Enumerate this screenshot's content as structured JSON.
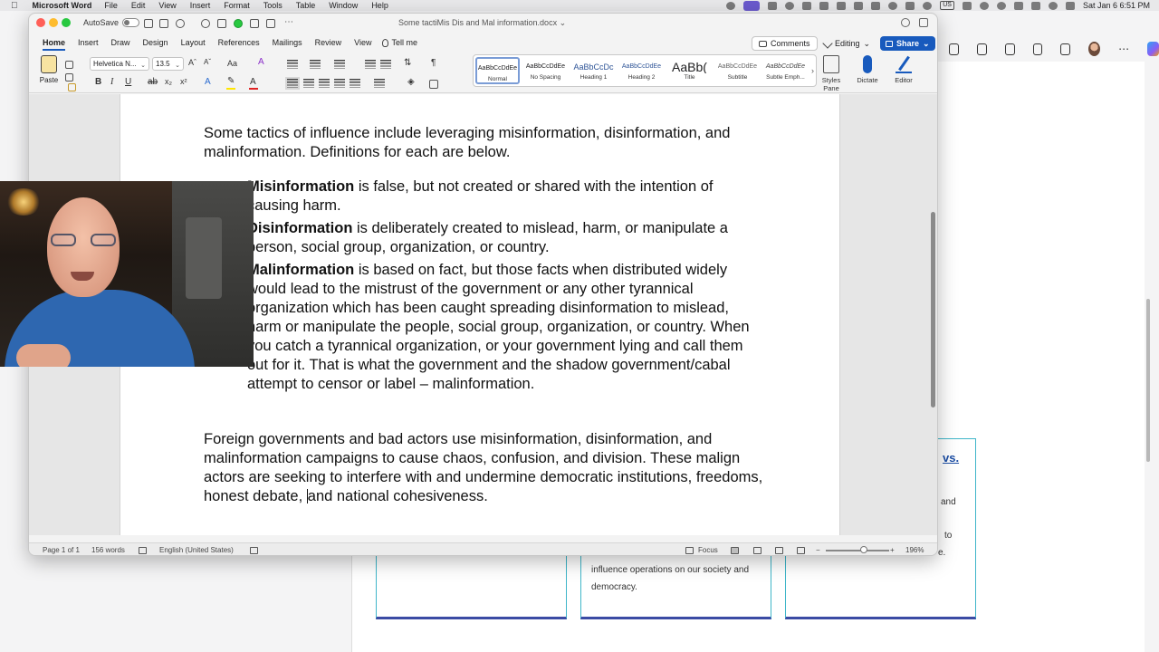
{
  "menubar": {
    "app_name": "Microsoft Word",
    "items": [
      "File",
      "Edit",
      "View",
      "Insert",
      "Format",
      "Tools",
      "Table",
      "Window",
      "Help"
    ],
    "status_kb": "US",
    "datetime": "Sat Jan 6  6:51 PM"
  },
  "word": {
    "autosave_label": "AutoSave",
    "doc_title": "Some tactiMis Dis and Mal information.docx",
    "tabs": [
      "Home",
      "Insert",
      "Draw",
      "Design",
      "Layout",
      "References",
      "Mailings",
      "Review",
      "View"
    ],
    "active_tab": "Home",
    "tellme_label": "Tell me",
    "comments_label": "Comments",
    "editing_label": "Editing",
    "share_label": "Share",
    "paste_label": "Paste",
    "font_name": "Helvetica N...",
    "font_size": "13.5",
    "styles": [
      {
        "preview": "AaBbCcDdEe",
        "name": "Normal"
      },
      {
        "preview": "AaBbCcDdEe",
        "name": "No Spacing"
      },
      {
        "preview": "AaBbCcDc",
        "name": "Heading 1"
      },
      {
        "preview": "AaBbCcDdEe",
        "name": "Heading 2"
      },
      {
        "preview": "AaBb(",
        "name": "Title"
      },
      {
        "preview": "AaBbCcDdEe",
        "name": "Subtitle"
      },
      {
        "preview": "AaBbCcDdEe",
        "name": "Subtle Emph..."
      }
    ],
    "selected_style": "Normal",
    "styles_pane_label": "Styles Pane",
    "dictate_label": "Dictate",
    "editor_label": "Editor",
    "colors": {
      "accent": "#185abd",
      "highlight": "#ffe600",
      "font_color": "#e02424"
    }
  },
  "document": {
    "intro": "Some tactics of influence include leveraging misinformation, disinformation, and malinformation.  Definitions for each are below.",
    "definitions": [
      {
        "term": "Misinformation",
        "text": " is false, but not created or shared with the intention of causing harm."
      },
      {
        "term": "Disinformation",
        "text": " is deliberately created to mislead, harm, or manipulate a person, social group, organization, or country."
      },
      {
        "term": "Malinformation",
        "text": " is based on fact, but those facts when distributed widely would lead to the mistrust of the government or any other tyrannical organization which has been caught spreading disinformation to mislead, harm or manipulate the people, social group, organization, or country. When you catch a tyrannical organization, or your government lying and call them out for it. That is what the government and the shadow government/cabal attempt to censor or label – malinformation."
      }
    ],
    "closing_before_cursor": "Foreign governments and bad actors use misinformation, disinformation, and malinformation campaigns to cause chaos, confusion, and division. These malign actors are seeking to interfere with and undermine democratic institutions, freedoms, honest debate, ",
    "closing_after_cursor": "and national cohesiveness."
  },
  "statusbar": {
    "page": "Page 1 of 1",
    "words": "156 words",
    "language": "English (United States)",
    "focus_label": "Focus",
    "zoom": "196%",
    "zoom_level": 0.6
  },
  "background_page": {
    "card2_text": "influence operations on our society and democracy.",
    "card3_link": "vs.",
    "card3_fragments": [
      "and",
      "to",
      "e."
    ]
  }
}
